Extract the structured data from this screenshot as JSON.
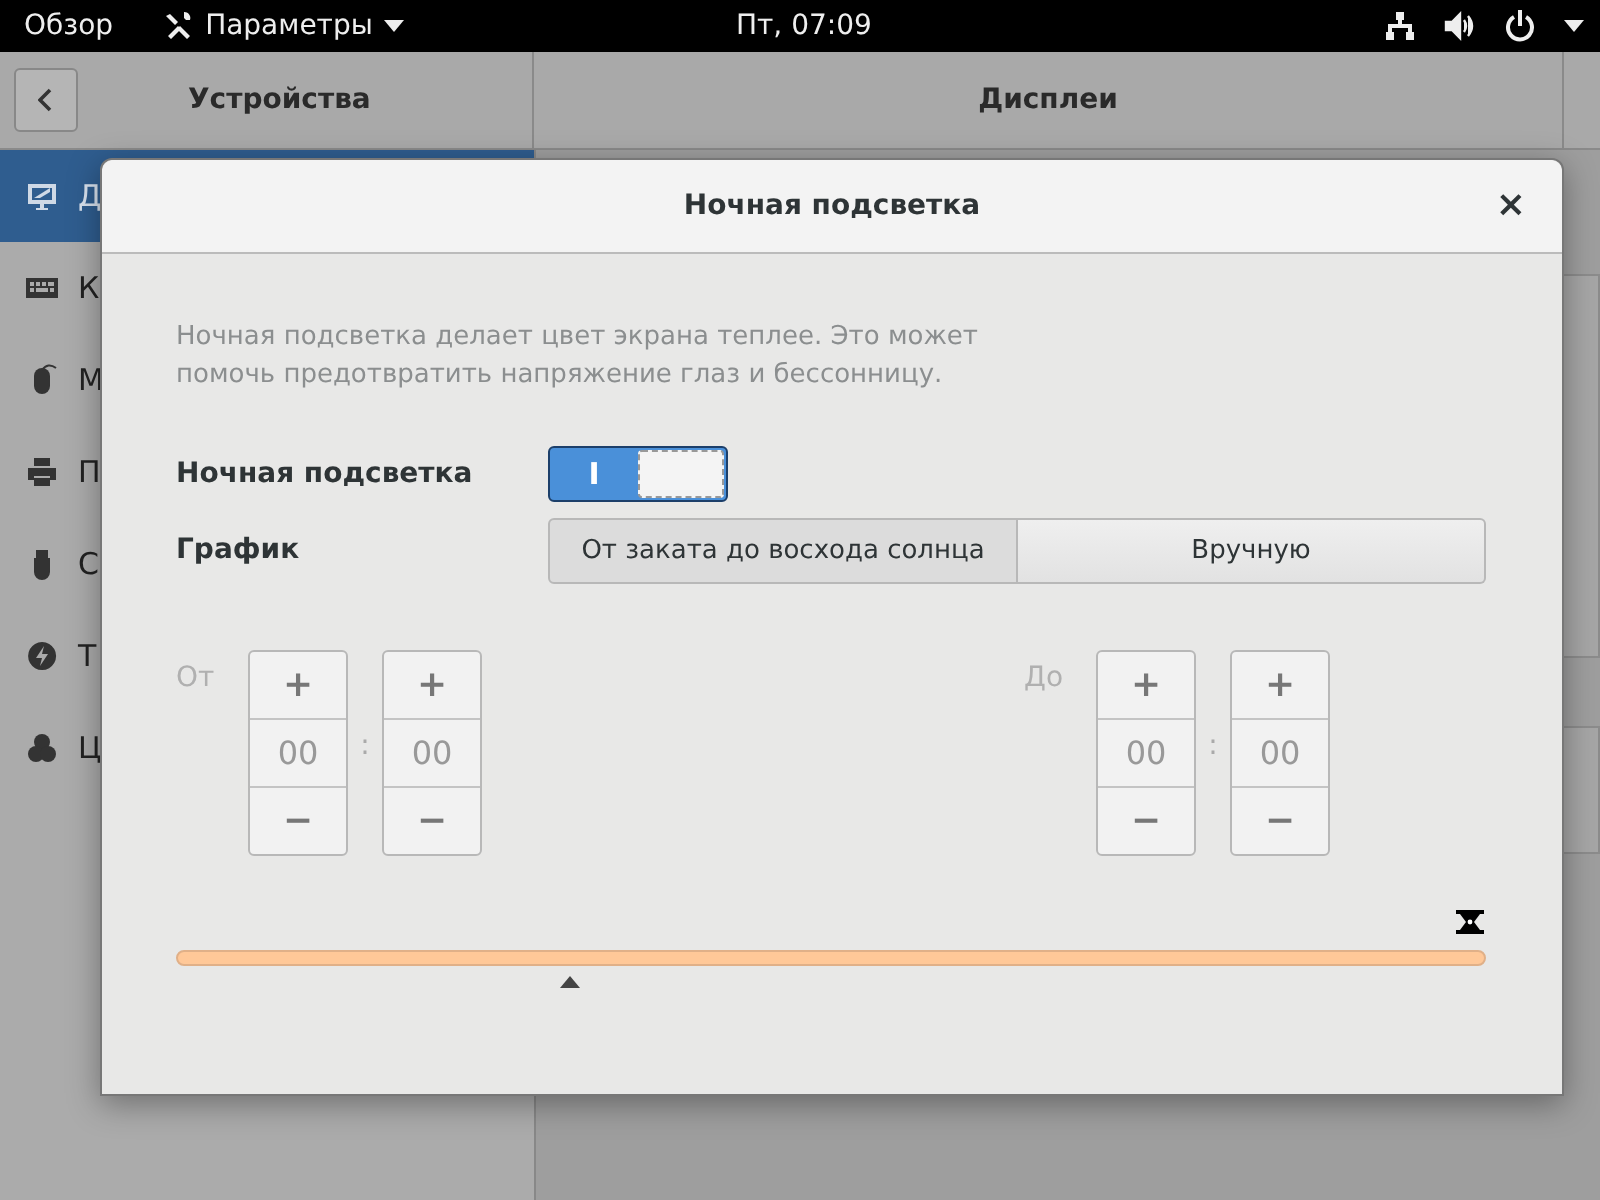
{
  "top_bar": {
    "activities": "Обзор",
    "app_menu": "Параметры",
    "clock": "Пт, 07:09"
  },
  "header": {
    "left_title": "Устройства",
    "right_title": "Дисплеи"
  },
  "sidebar": {
    "items": [
      {
        "label": "Д",
        "selected": true
      },
      {
        "label": "К",
        "selected": false
      },
      {
        "label": "М",
        "selected": false
      },
      {
        "label": "П",
        "selected": false
      },
      {
        "label": "С",
        "selected": false
      },
      {
        "label": "Т",
        "selected": false
      },
      {
        "label": "Ц",
        "selected": false
      }
    ]
  },
  "dialog": {
    "title": "Ночная подсветка",
    "close": "×",
    "description": "Ночная подсветка делает цвет экрана теплее. Это может помочь предотвратить напряжение глаз и бессонницу.",
    "switch": {
      "label": "Ночная подсветка",
      "on": true,
      "on_glyph": "I"
    },
    "schedule": {
      "label": "График",
      "options": [
        {
          "label": "От заката до восхода солнца",
          "selected": true
        },
        {
          "label": "Вручную",
          "selected": false
        }
      ]
    },
    "times": [
      {
        "label": "От",
        "hours": "00",
        "minutes": "00",
        "separator": ":",
        "plus": "+",
        "minus": "−"
      },
      {
        "label": "До",
        "hours": "00",
        "minutes": "00",
        "separator": ":",
        "plus": "+",
        "minus": "−"
      }
    ],
    "timeline": {
      "level": 0.3
    }
  }
}
